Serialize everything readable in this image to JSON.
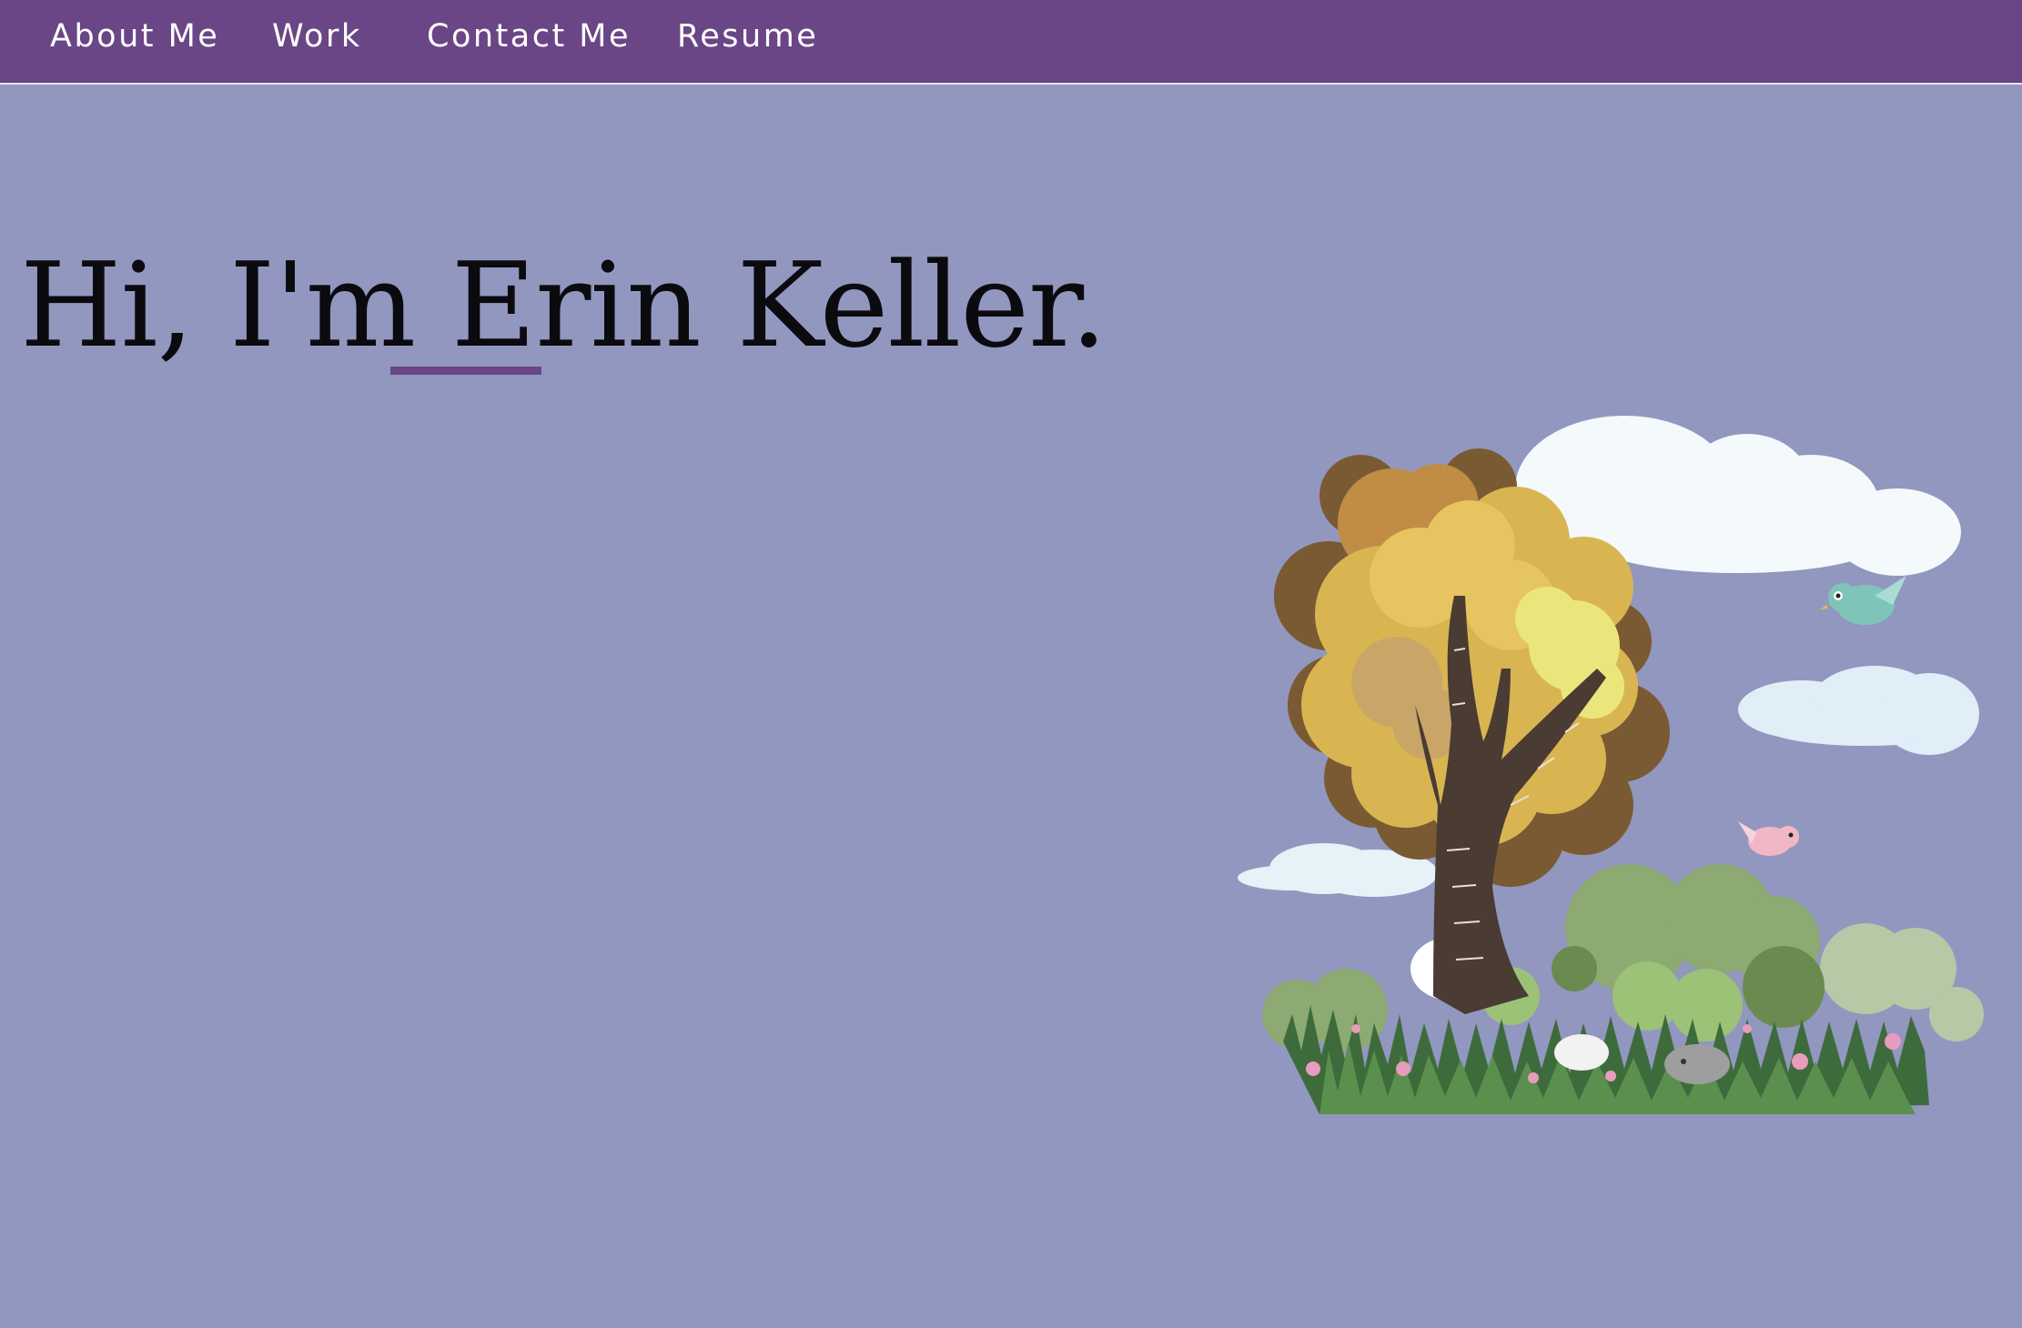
{
  "nav": {
    "items": [
      {
        "label": "About Me"
      },
      {
        "label": "Work"
      },
      {
        "label": "Contact Me"
      },
      {
        "label": "Resume"
      }
    ]
  },
  "hero": {
    "greeting": "Hi, I'm ",
    "name": "Erin",
    "surname": " Keller."
  },
  "colors": {
    "background": "#9297bf",
    "navbar": "#6a4686",
    "accent_underline": "#6a4686",
    "text": "#0b0b0f"
  },
  "illustration": {
    "icon": "tree-landscape-illustration"
  }
}
